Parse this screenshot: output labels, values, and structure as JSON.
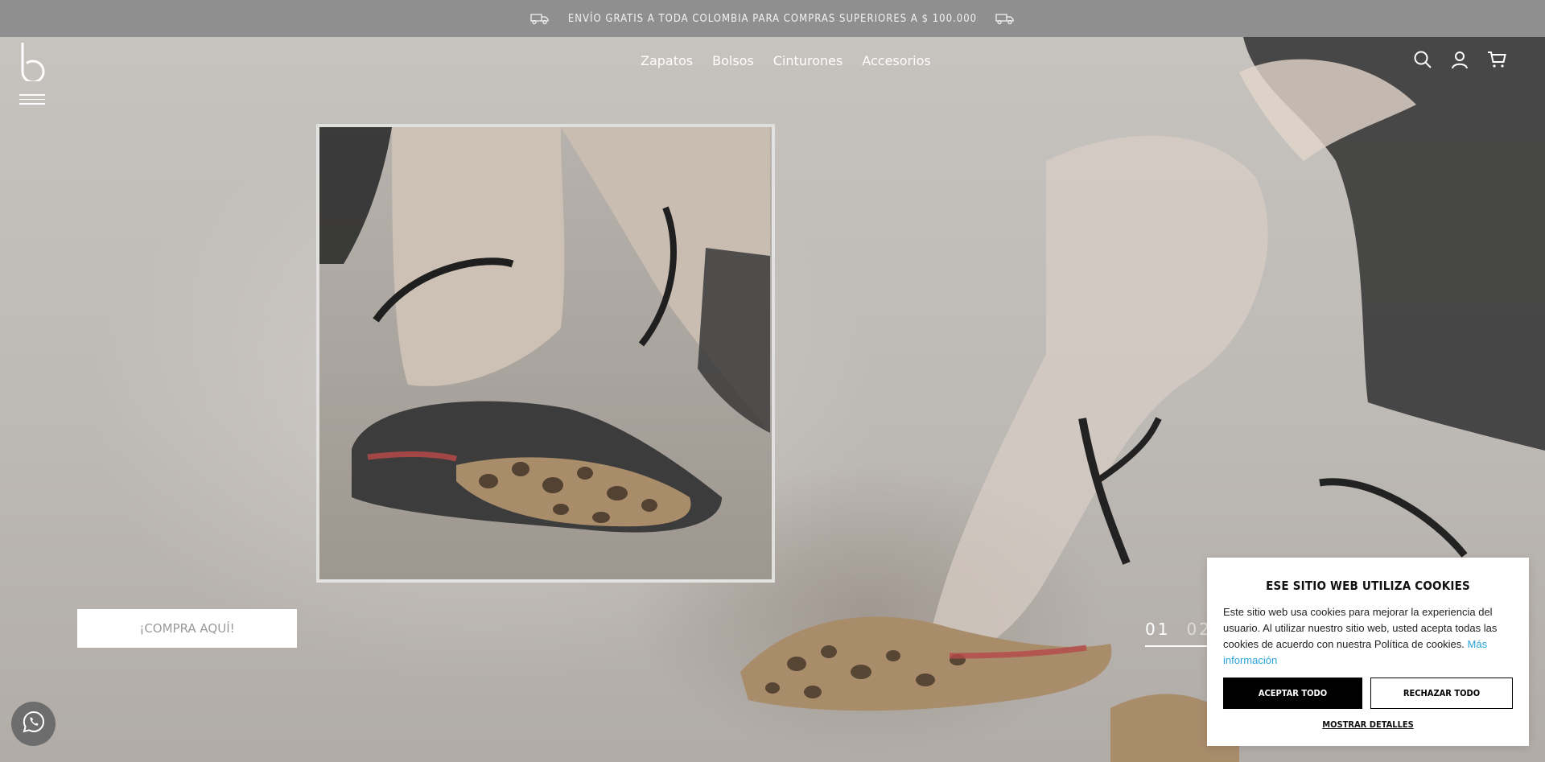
{
  "banner": {
    "text": "ENVÍO GRATIS A TODA COLOMBIA PARA COMPRAS SUPERIORES A $ 100.000",
    "left_icon": "truck-icon",
    "right_icon": "truck-icon"
  },
  "header": {
    "logo_icon": "brand-b-logo",
    "menu_icon": "hamburger-menu-icon",
    "nav": [
      "Zapatos",
      "Bolsos",
      "Cinturones",
      "Accesorios"
    ],
    "icons": [
      "search-icon",
      "user-icon",
      "cart-icon"
    ]
  },
  "hero": {
    "cta_label": "¡COMPRA AQUÍ!",
    "slides": [
      "01",
      "02"
    ],
    "active_slide": "01"
  },
  "whatsapp": {
    "icon": "whatsapp-icon"
  },
  "cookie": {
    "title": "ESE SITIO WEB UTILIZA COOKIES",
    "body": "Este sitio web usa cookies para mejorar la experiencia del usuario. Al utilizar nuestro sitio web, usted acepta todas las cookies de acuerdo con nuestra Política de cookies.",
    "more_link": "Más información",
    "accept_label": "ACEPTAR TODO",
    "reject_label": "RECHAZAR TODO",
    "details_label": "MOSTRAR DETALLES"
  },
  "colors": {
    "banner_bg": "#8f8f8f",
    "link": "#2aa3d8",
    "accept_bg": "#000000"
  }
}
